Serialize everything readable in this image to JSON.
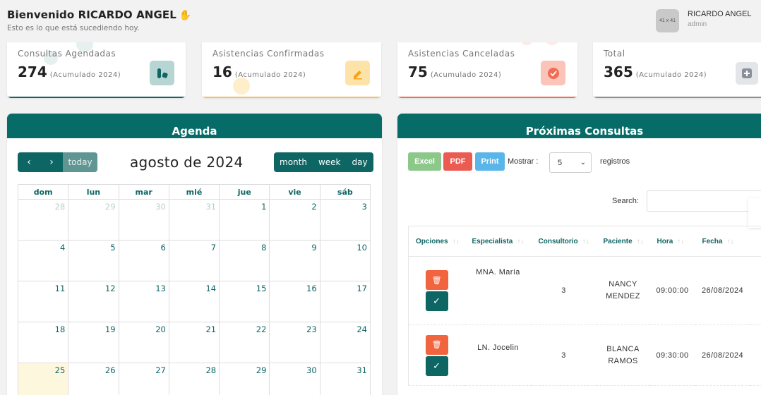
{
  "header": {
    "welcome": "Bienvenido RICARDO ANGEL",
    "subtitle": "Esto es lo que está sucediendo hoy.",
    "avatar_placeholder": "41 x 41",
    "user_name": "RICARDO ANGEL",
    "user_role": "admin"
  },
  "stats": [
    {
      "label": "Consultas Agendadas",
      "value": "274",
      "note": "(Acumulado 2024)",
      "icon": "pills-icon",
      "color": "#0d6564",
      "icon_bg": "#b7d5d2"
    },
    {
      "label": "Asistencias Confirmadas",
      "value": "16",
      "note": "(Acumulado 2024)",
      "icon": "pencil-icon",
      "color": "#f6c15a",
      "icon_bg": "#fde3a7"
    },
    {
      "label": "Asistencias Canceladas",
      "value": "75",
      "note": "(Acumulado 2024)",
      "icon": "check-circle-icon",
      "color": "#f26b55",
      "icon_bg": "#fbc4b8"
    },
    {
      "label": "Total",
      "value": "365",
      "note": "(Acumulado 2024)",
      "icon": "plus-icon",
      "color": "#8a8f99",
      "icon_bg": "#e4e5e8"
    }
  ],
  "agenda": {
    "title": "Agenda",
    "month_title": "agosto de 2024",
    "today_label": "today",
    "views": [
      "month",
      "week",
      "day"
    ],
    "weekdays": [
      "dom",
      "lun",
      "mar",
      "mié",
      "jue",
      "vie",
      "sáb"
    ],
    "weeks": [
      [
        "28",
        "29",
        "30",
        "31",
        "1",
        "2",
        "3"
      ],
      [
        "4",
        "5",
        "6",
        "7",
        "8",
        "9",
        "10"
      ],
      [
        "11",
        "12",
        "13",
        "14",
        "15",
        "16",
        "17"
      ],
      [
        "18",
        "19",
        "20",
        "21",
        "22",
        "23",
        "24"
      ],
      [
        "25",
        "26",
        "27",
        "28",
        "29",
        "30",
        "31"
      ]
    ]
  },
  "consultas": {
    "title": "Próximas Consultas",
    "export_buttons": [
      "Excel",
      "PDF",
      "Print"
    ],
    "show_label": "Mostrar :",
    "page_size": "5",
    "records_label": "registros",
    "search_label": "Search:",
    "columns": [
      "Opciones",
      "Especialista",
      "Consultorio",
      "Paciente",
      "Hora",
      "Fecha"
    ],
    "rows": [
      {
        "especialista": "MNA. María",
        "consultorio": "3",
        "paciente": "NANCY MENDEZ",
        "hora": "09:00:00",
        "fecha": "26/08/2024"
      },
      {
        "especialista": "LN. Jocelin",
        "consultorio": "3",
        "paciente": "BLANCA RAMOS",
        "hora": "09:30:00",
        "fecha": "26/08/2024"
      }
    ]
  }
}
